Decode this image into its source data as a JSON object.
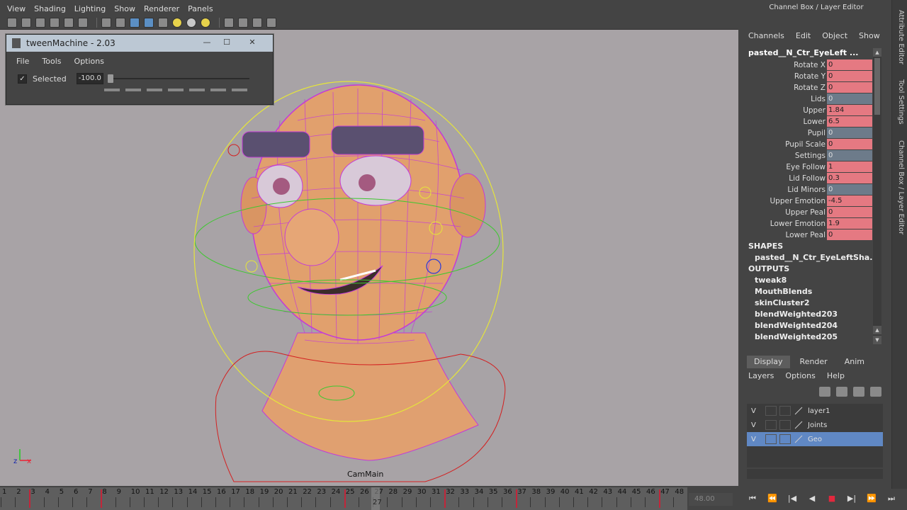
{
  "viewport": {
    "menus": [
      "View",
      "Shading",
      "Lighting",
      "Show",
      "Renderer",
      "Panels"
    ],
    "camera": "CamMain",
    "axis": {
      "x": "x",
      "z": "z"
    }
  },
  "tween": {
    "title": "tweenMachine - 2.03",
    "menus": [
      "File",
      "Tools",
      "Options"
    ],
    "checkbox_label": "Selected",
    "value": "-100.0",
    "slider_fraction": 0
  },
  "right_panel": {
    "title": "Channel Box / Layer Editor",
    "side_tabs": [
      "Attribute Editor",
      "Tool Settings",
      "Channel Box / Layer Editor"
    ],
    "cb_menus": [
      "Channels",
      "Edit",
      "Object",
      "Show"
    ],
    "node_name": "pasted__N_Ctr_EyeLeft ...",
    "attributes": [
      {
        "name": "Rotate X",
        "value": "0",
        "locked": false
      },
      {
        "name": "Rotate Y",
        "value": "0",
        "locked": false
      },
      {
        "name": "Rotate Z",
        "value": "0",
        "locked": false
      },
      {
        "name": "Lids",
        "value": "0",
        "locked": true
      },
      {
        "name": "Upper",
        "value": "1.84",
        "locked": false
      },
      {
        "name": "Lower",
        "value": "6.5",
        "locked": false
      },
      {
        "name": "Pupil",
        "value": "0",
        "locked": true
      },
      {
        "name": "Pupil Scale",
        "value": "0",
        "locked": false
      },
      {
        "name": "Settings",
        "value": "0",
        "locked": true
      },
      {
        "name": "Eye Follow",
        "value": "1",
        "locked": false
      },
      {
        "name": "Lid Follow",
        "value": "0.3",
        "locked": false
      },
      {
        "name": "Lid Minors",
        "value": "0",
        "locked": true
      },
      {
        "name": "Upper Emotion",
        "value": "-4.5",
        "locked": false
      },
      {
        "name": "Upper Peal",
        "value": "0",
        "locked": false
      },
      {
        "name": "Lower Emotion",
        "value": "1.9",
        "locked": false
      },
      {
        "name": "Lower Peal",
        "value": "0",
        "locked": false
      }
    ],
    "shapes_label": "SHAPES",
    "shape_item": "pasted__N_Ctr_EyeLeftSha...",
    "outputs_label": "OUTPUTS",
    "outputs": [
      "tweak8",
      "MouthBlends",
      "skinCluster2",
      "blendWeighted203",
      "blendWeighted204",
      "blendWeighted205"
    ],
    "le_tabs": [
      "Display",
      "Render",
      "Anim"
    ],
    "le_menus": [
      "Layers",
      "Options",
      "Help"
    ],
    "layers": [
      {
        "v": "V",
        "name": "layer1",
        "selected": false
      },
      {
        "v": "V",
        "name": "Joints",
        "selected": false
      },
      {
        "v": "V",
        "name": "Geo",
        "selected": true
      }
    ]
  },
  "timeline": {
    "ticks": [
      "1",
      "2",
      "3",
      "4",
      "5",
      "6",
      "7",
      "8",
      "9",
      "10",
      "11",
      "12",
      "13",
      "14",
      "15",
      "16",
      "17",
      "18",
      "19",
      "20",
      "21",
      "22",
      "23",
      "24",
      "25",
      "26",
      "27",
      "28",
      "29",
      "30",
      "31",
      "32",
      "33",
      "34",
      "35",
      "36",
      "37",
      "38",
      "39",
      "40",
      "41",
      "42",
      "43",
      "44",
      "45",
      "46",
      "47",
      "48"
    ],
    "keys": [
      3,
      8,
      25,
      32,
      37,
      47
    ],
    "current_frame": "27",
    "end_frame": "48.00"
  },
  "colors": {
    "attr_keyed": "#e57982",
    "attr_locked": "#6d7b8a",
    "layer_selected": "#6088c4",
    "key": "#c2263a"
  }
}
